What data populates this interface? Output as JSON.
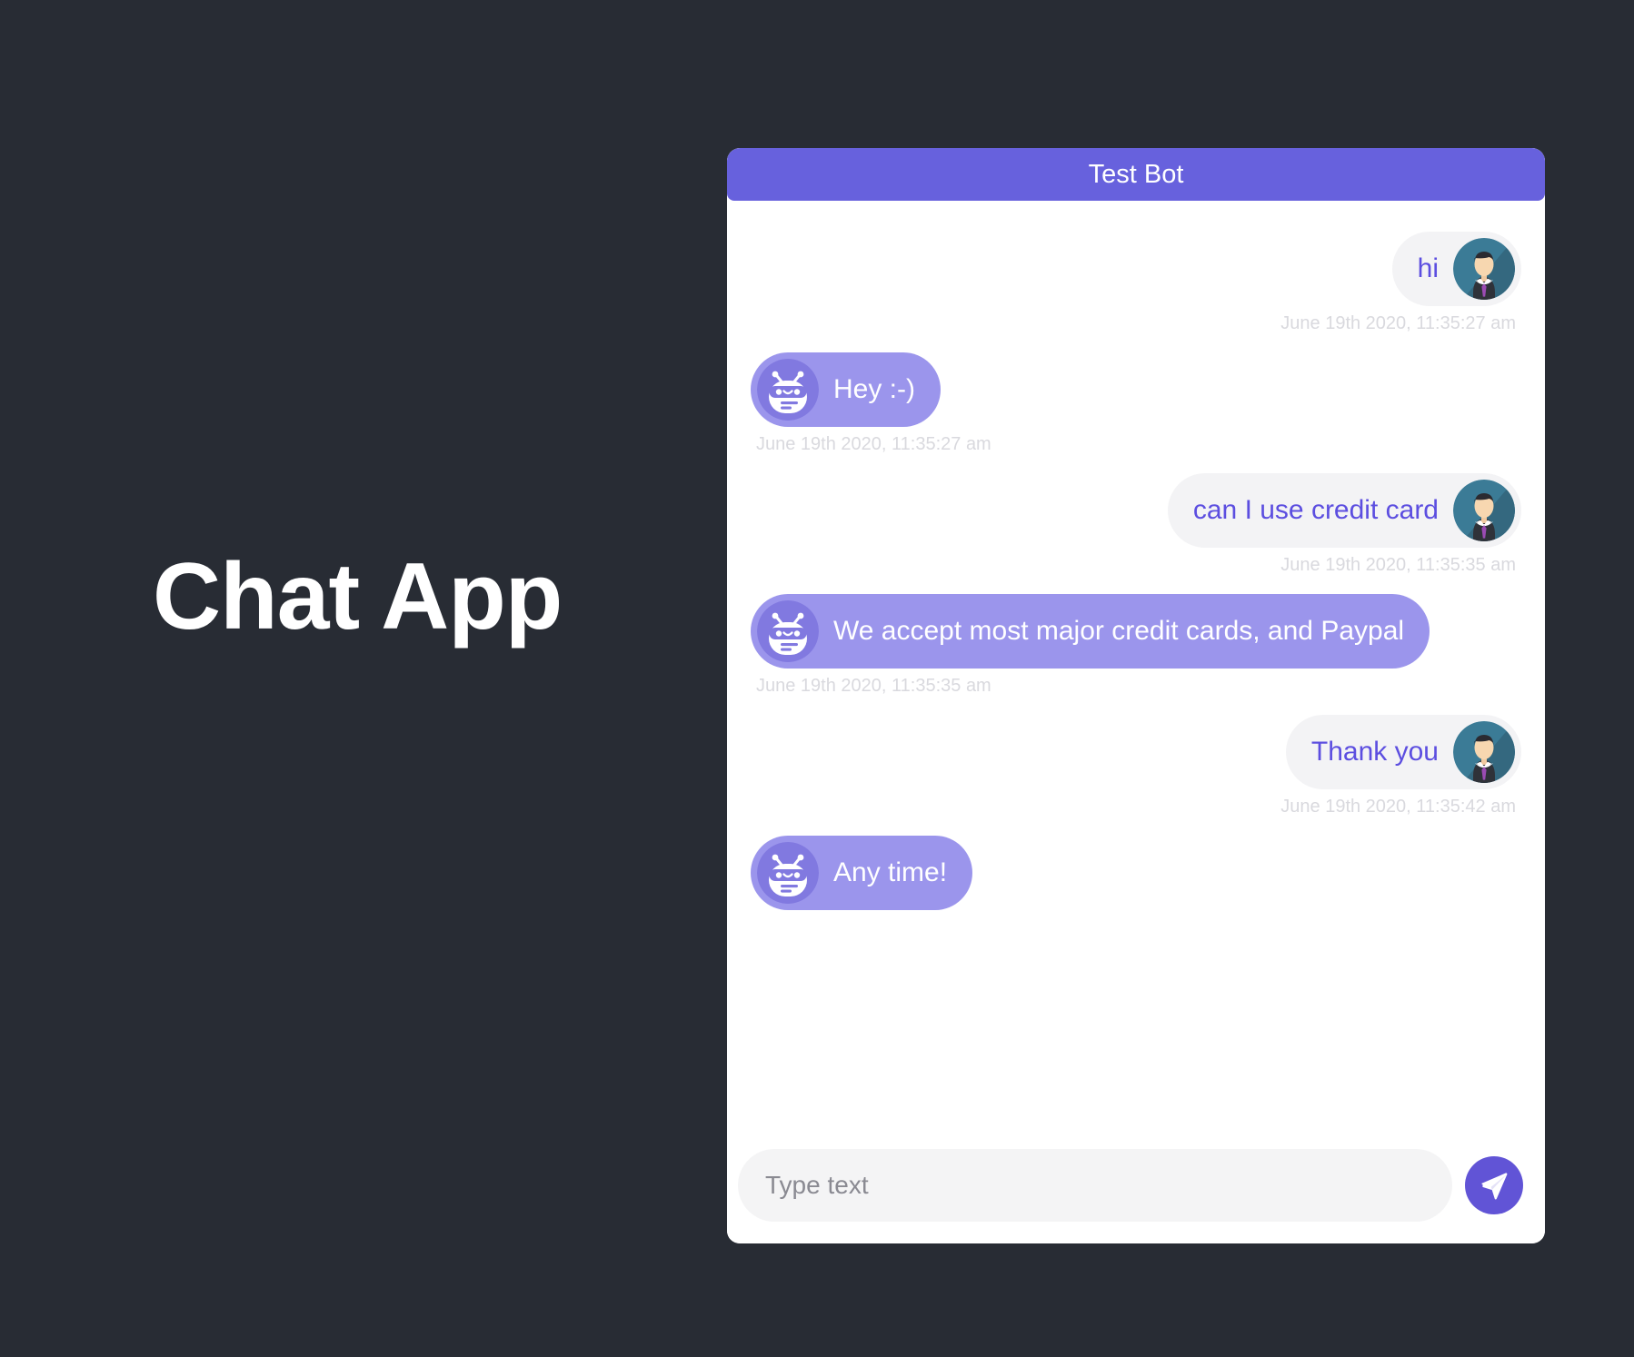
{
  "page": {
    "background_color": "#282c34",
    "title": "Chat App"
  },
  "chat": {
    "header": {
      "title": "Test Bot",
      "background_color": "#6761dd",
      "text_color": "#ffffff"
    },
    "colors": {
      "bot_bubble": "#9b95ec",
      "bot_text": "#ffffff",
      "user_bubble": "#f3f3f5",
      "user_text": "#5c4ee0",
      "timestamp": "#d9d9de",
      "send_button": "#6154d6",
      "card_background": "#ffffff"
    },
    "messages": [
      {
        "sender": "user",
        "text": "hi",
        "timestamp": "June 19th 2020, 11:35:27 am",
        "avatar": "user-avatar-businessman"
      },
      {
        "sender": "bot",
        "text": "Hey :-)",
        "timestamp": "June 19th 2020, 11:35:27 am",
        "avatar": "bot-avatar-robot"
      },
      {
        "sender": "user",
        "text": "can I use credit card",
        "timestamp": "June 19th 2020, 11:35:35 am",
        "avatar": "user-avatar-businessman"
      },
      {
        "sender": "bot",
        "text": "We accept most major credit cards, and Paypal",
        "timestamp": "June 19th 2020, 11:35:35 am",
        "avatar": "bot-avatar-robot"
      },
      {
        "sender": "user",
        "text": "Thank you",
        "timestamp": "June 19th 2020, 11:35:42 am",
        "avatar": "user-avatar-businessman"
      },
      {
        "sender": "bot",
        "text": "Any time!",
        "timestamp": "",
        "avatar": "bot-avatar-robot"
      }
    ],
    "composer": {
      "placeholder": "Type text",
      "value": "",
      "send_icon": "send-paper-plane-icon"
    }
  }
}
